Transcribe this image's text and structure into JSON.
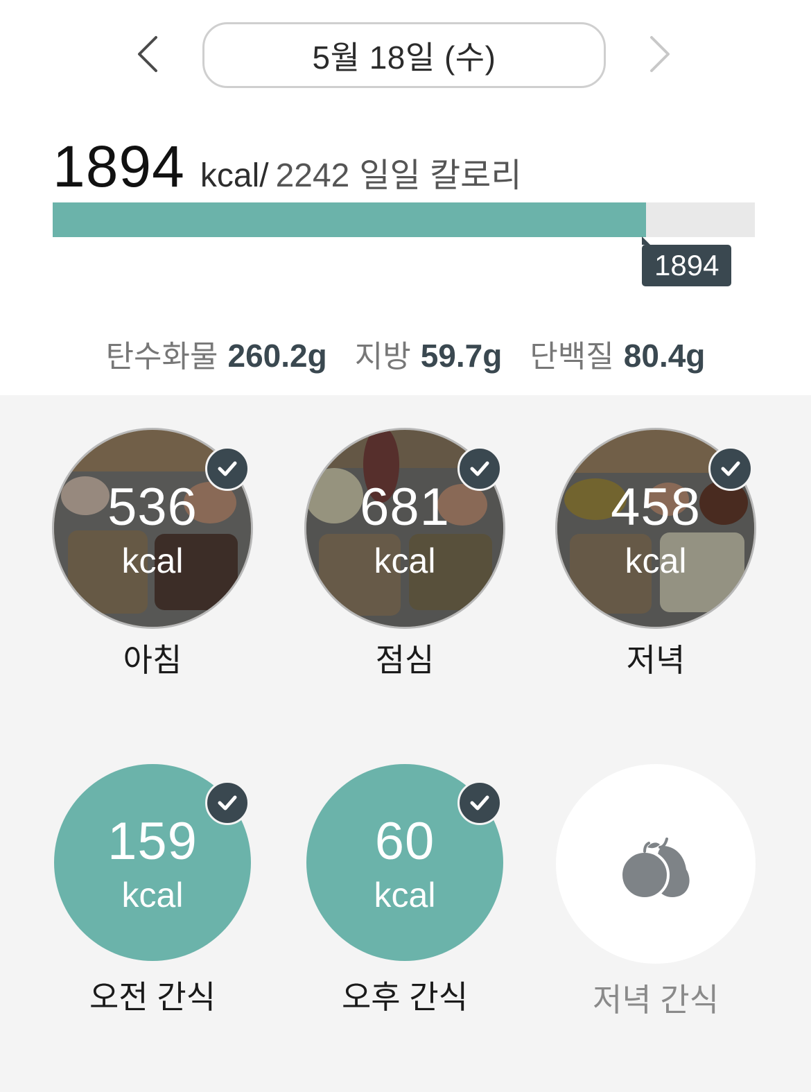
{
  "header": {
    "prev_icon": "chevron-left-icon",
    "next_icon": "chevron-right-icon",
    "date": "5월 18일 (수)"
  },
  "summary": {
    "consumed": "1894",
    "unit": "kcal",
    "separator": "/",
    "target": "2242",
    "label": "일일 칼로리",
    "progress_fraction": 0.845,
    "tooltip": "1894",
    "colors": {
      "fill": "#6bb3aa",
      "track": "#e9e9e9",
      "tooltip": "#3a4850"
    }
  },
  "macros": [
    {
      "name": "탄수화물",
      "value": "260.2g"
    },
    {
      "name": "지방",
      "value": "59.7g"
    },
    {
      "name": "단백질",
      "value": "80.4g"
    }
  ],
  "meals": [
    {
      "kcal": "536",
      "unit": "kcal",
      "label": "아침",
      "checked": true,
      "style": "photo"
    },
    {
      "kcal": "681",
      "unit": "kcal",
      "label": "점심",
      "checked": true,
      "style": "photo"
    },
    {
      "kcal": "458",
      "unit": "kcal",
      "label": "저녁",
      "checked": true,
      "style": "photo"
    },
    {
      "kcal": "159",
      "unit": "kcal",
      "label": "오전 간식",
      "checked": true,
      "style": "teal"
    },
    {
      "kcal": "60",
      "unit": "kcal",
      "label": "오후 간식",
      "checked": true,
      "style": "teal"
    },
    {
      "label": "저녁 간식",
      "checked": false,
      "style": "empty",
      "icon": "fruit-icon"
    }
  ]
}
